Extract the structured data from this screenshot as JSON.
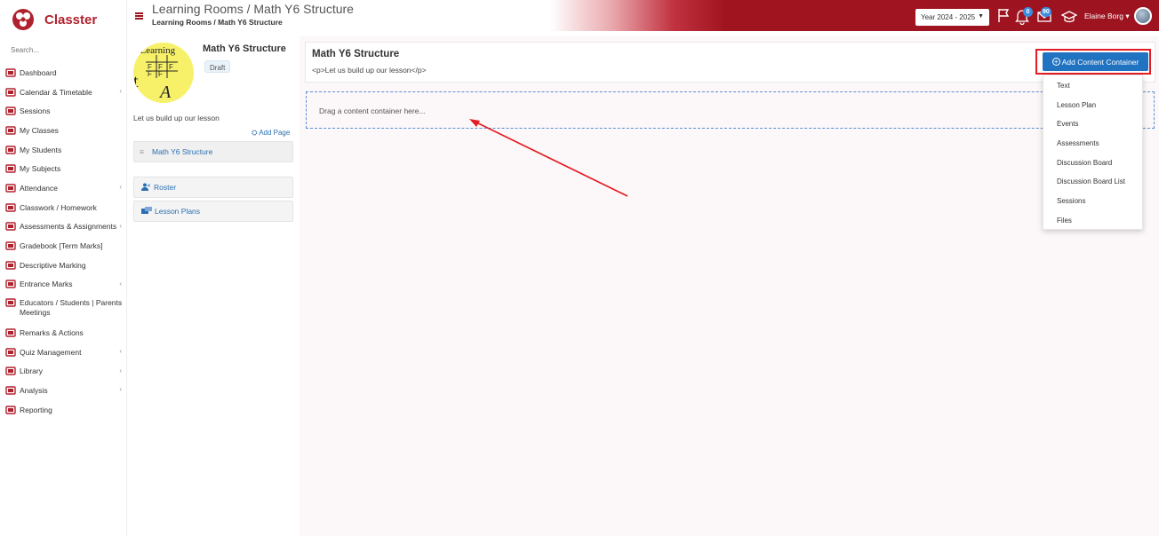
{
  "sidebar": {
    "brand": "Classter",
    "search_placeholder": "Search...",
    "items": [
      {
        "label": "Dashboard",
        "icon": "monitor-icon"
      },
      {
        "label": "Calendar & Timetable",
        "icon": "calendar-icon",
        "chevron": true
      },
      {
        "label": "Sessions",
        "icon": "sessions-icon"
      },
      {
        "label": "My Classes",
        "icon": "classes-icon"
      },
      {
        "label": "My Students",
        "icon": "students-icon"
      },
      {
        "label": "My Subjects",
        "icon": "book-icon"
      },
      {
        "label": "Attendance",
        "icon": "attendance-icon",
        "chevron": true
      },
      {
        "label": "Classwork / Homework",
        "icon": "list-icon"
      },
      {
        "label": "Assessments & Assignments",
        "icon": "edit-icon",
        "chevron": true
      },
      {
        "label": "Gradebook [Term Marks]",
        "icon": "gradebook-icon"
      },
      {
        "label": "Descriptive Marking",
        "icon": "chart-icon"
      },
      {
        "label": "Entrance Marks",
        "icon": "clipboard-icon",
        "chevron": true
      },
      {
        "label": "Educators / Students | Parents Meetings",
        "icon": "meeting-icon",
        "chevron": true
      },
      {
        "label": "Remarks & Actions",
        "icon": "shuffle-icon"
      },
      {
        "label": "Quiz Management",
        "icon": "quiz-icon",
        "chevron": true
      },
      {
        "label": "Library",
        "icon": "library-icon",
        "chevron": true
      },
      {
        "label": "Analysis",
        "icon": "analysis-icon",
        "chevron": true
      },
      {
        "label": "Reporting",
        "icon": "printer-icon"
      }
    ],
    "chevron_glyph": "‹"
  },
  "header": {
    "title": "Learning Rooms / Math Y6 Structure",
    "breadcrumb": "Learning Rooms / Math Y6 Structure",
    "year": "Year 2024 - 2025",
    "notifications_count": "0",
    "messages_count": "90",
    "user_name": "Elaine Borg",
    "accent": "#9d1320"
  },
  "room": {
    "title": "Math Y6 Structure",
    "status": "Draft",
    "description": "Let us build up our lesson",
    "add_page": "Add Page",
    "image_text_top": "rt Learning",
    "image_letter": "A",
    "image_cells": [
      "F",
      "F",
      "F",
      "F",
      "F"
    ],
    "pages": [
      "Math Y6 Structure"
    ],
    "links": [
      "Roster",
      "Lesson Plans"
    ]
  },
  "main": {
    "content_title": "Math Y6 Structure",
    "content_desc": "<p>Let us build up our lesson</p>",
    "dropzone": "Drag a content container here...",
    "add_container": "Add Content Container",
    "menu": [
      "Text",
      "Lesson Plan",
      "Events",
      "Assessments",
      "Discussion Board",
      "Discussion Board List",
      "Sessions",
      "Files"
    ],
    "button_color": "#2073c1",
    "highlight_color": "#e31b23"
  }
}
